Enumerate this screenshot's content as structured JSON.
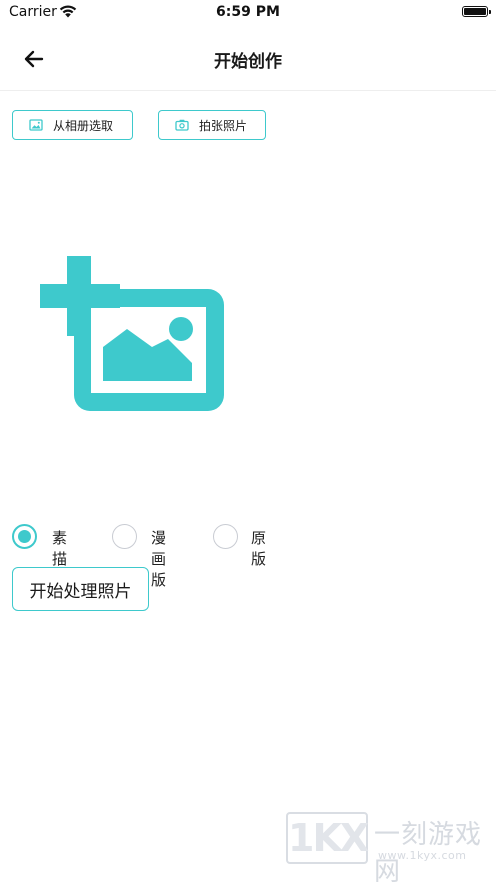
{
  "status_bar": {
    "carrier": "Carrier",
    "time": "6:59 PM",
    "battery_level": 1.0
  },
  "nav": {
    "title": "开始创作",
    "back_icon": "arrow-left-icon"
  },
  "pickers": [
    {
      "label": "从相册选取",
      "icon": "image-icon"
    },
    {
      "label": "拍张照片",
      "icon": "camera-icon"
    }
  ],
  "placeholder": {
    "icon": "add-image-icon",
    "color": "#3ec9cc"
  },
  "modes": {
    "options": [
      "素描版",
      "漫画版",
      "原版"
    ],
    "selected_index": 0
  },
  "start_button": {
    "label": "开始处理照片"
  },
  "watermark": {
    "logo": "1KX",
    "text": "一刻游戏网",
    "url": "www.1kyx.com"
  },
  "colors": {
    "accent": "#3ec9cc",
    "radio_border": "#c9ccd3",
    "text": "#1a1a1a"
  }
}
